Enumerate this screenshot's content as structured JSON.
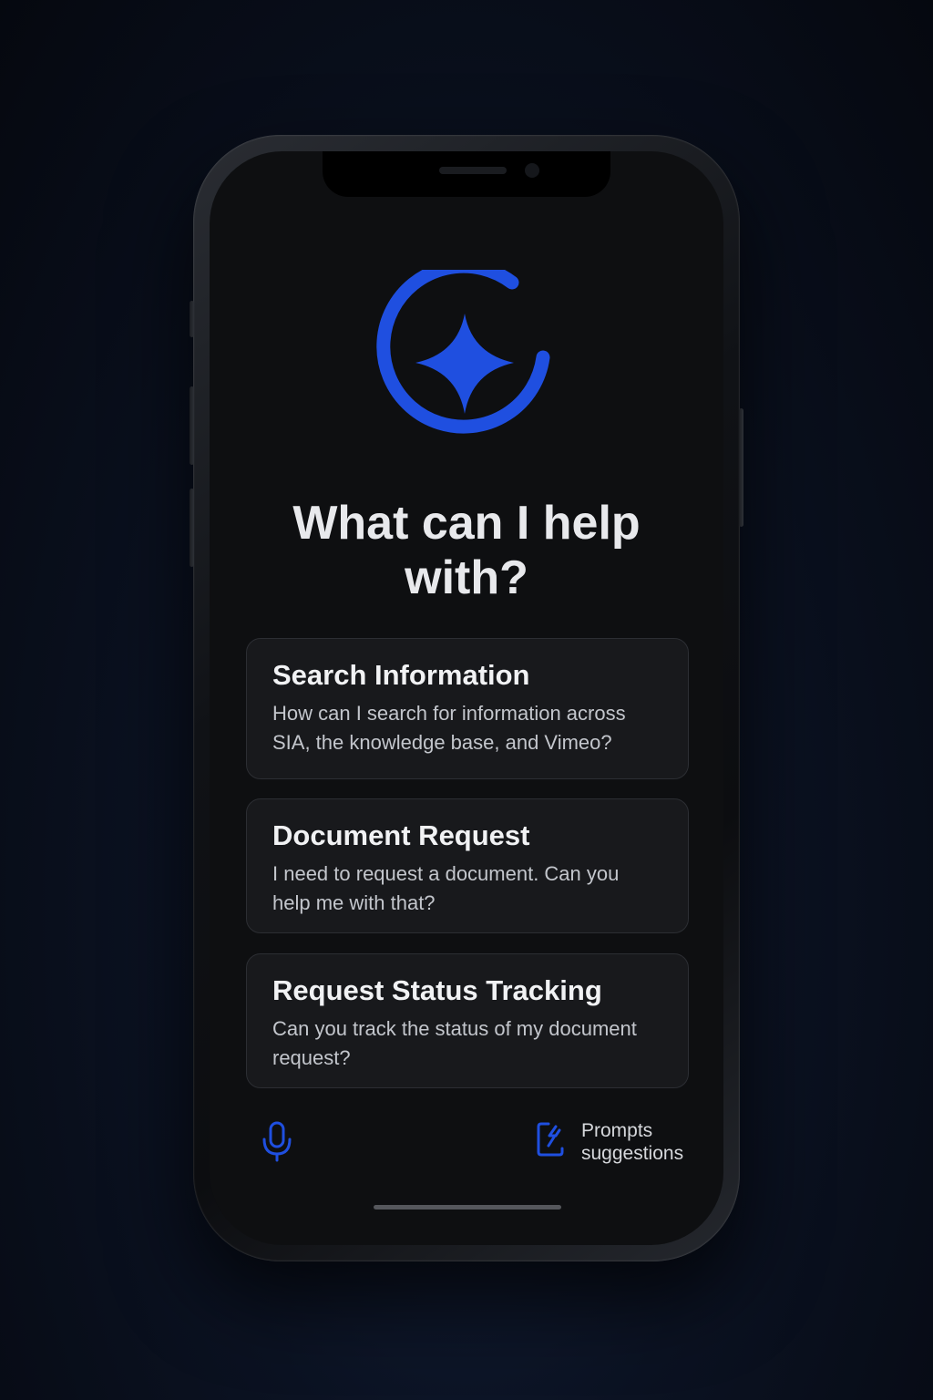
{
  "colors": {
    "accent": "#1f4fe0",
    "background": "#0e0f11",
    "card": "#18191c"
  },
  "logo": {
    "icon": "sparkle-ring-icon"
  },
  "heading": {
    "line1": "What can I help",
    "line2": "with?"
  },
  "cards": [
    {
      "title": "Search Information",
      "line1": "How can I search for information across",
      "line2": "SIA, the knowledge base, and Vimeo?"
    },
    {
      "title": "Document Request",
      "line1": "I need to request a document. Can you",
      "line2": "help me with that?"
    },
    {
      "title": "Request Status Tracking",
      "line1": "Can you track the status of my document",
      "line2": "request?"
    }
  ],
  "bottom_bar": {
    "mic_icon": "microphone-icon",
    "prompts_icon": "prompt-suggestions-icon",
    "prompts_line1": "Prompts",
    "prompts_line2": "suggestions"
  }
}
